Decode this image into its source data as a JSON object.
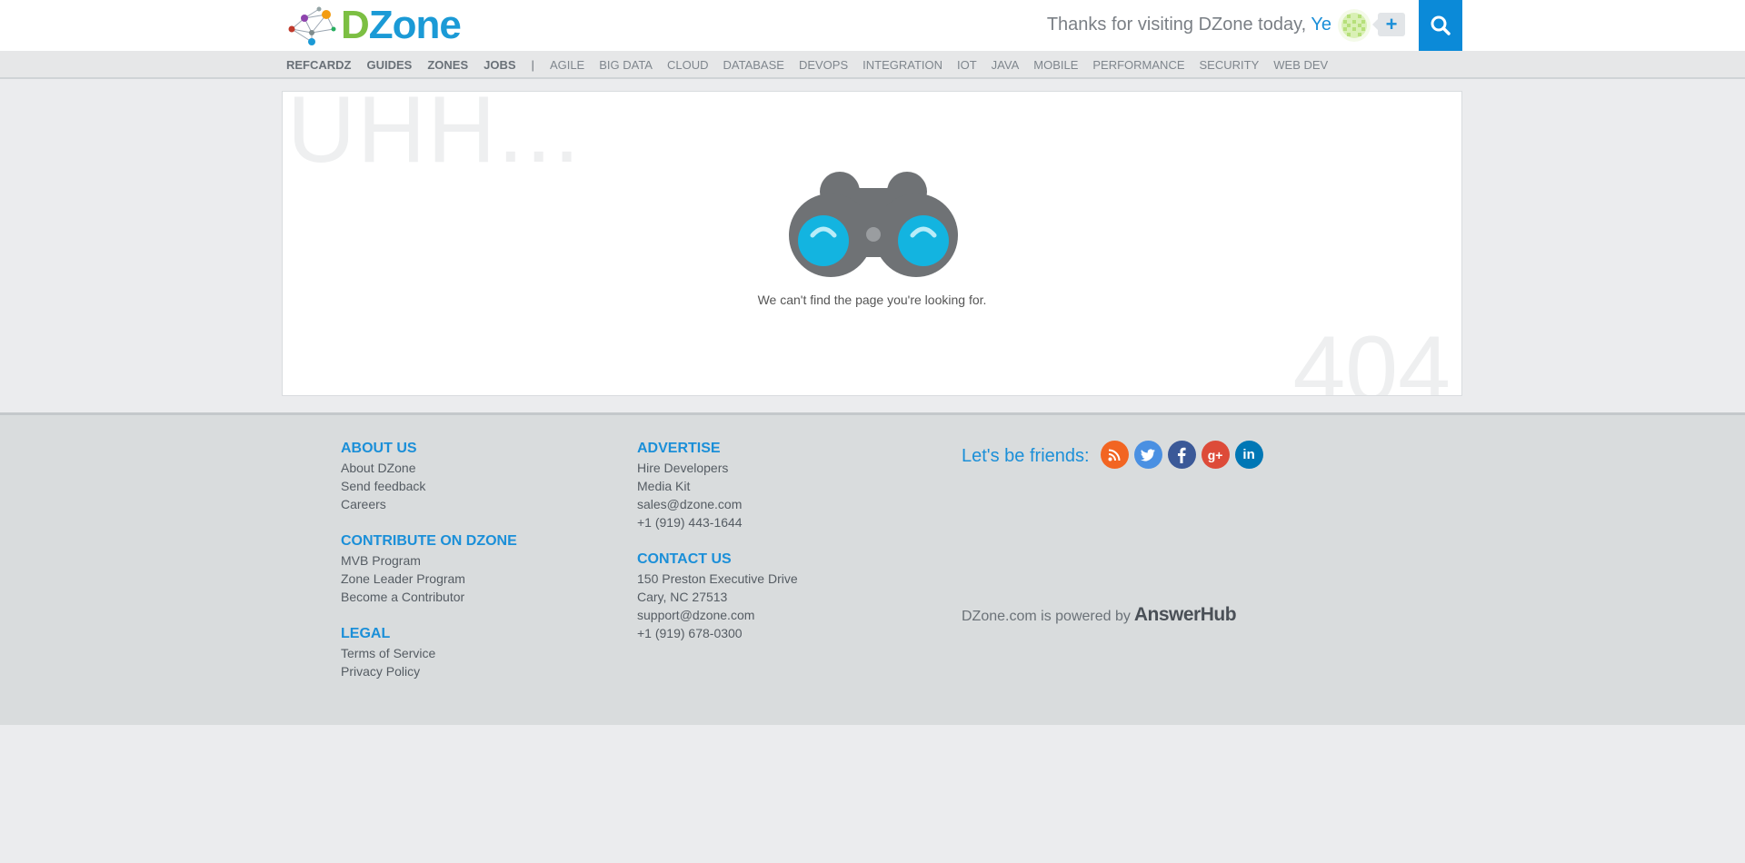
{
  "header": {
    "logo_d": "D",
    "logo_zone": "Zone",
    "greeting_prefix": "Thanks for visiting DZone today,",
    "greeting_user": "Ye",
    "plus_label": "+",
    "search_icon": "search-icon"
  },
  "nav": {
    "primary": [
      "REFCARDZ",
      "GUIDES",
      "ZONES",
      "JOBS"
    ],
    "separator": "|",
    "topics": [
      "AGILE",
      "BIG DATA",
      "CLOUD",
      "DATABASE",
      "DEVOPS",
      "INTEGRATION",
      "IOT",
      "JAVA",
      "MOBILE",
      "PERFORMANCE",
      "SECURITY",
      "WEB DEV"
    ]
  },
  "main": {
    "bg_text": "UHH...",
    "error_code": "404",
    "message": "We can't find the page you're looking for."
  },
  "footer": {
    "about": {
      "heading": "ABOUT US",
      "links": [
        "About DZone",
        "Send feedback",
        "Careers"
      ]
    },
    "contribute": {
      "heading": "CONTRIBUTE ON DZONE",
      "links": [
        "MVB Program",
        "Zone Leader Program",
        "Become a Contributor"
      ]
    },
    "legal": {
      "heading": "LEGAL",
      "links": [
        "Terms of Service",
        "Privacy Policy"
      ]
    },
    "advertise": {
      "heading": "ADVERTISE",
      "links": [
        "Hire Developers",
        "Media Kit",
        "sales@dzone.com",
        "+1 (919) 443-1644"
      ]
    },
    "contact": {
      "heading": "CONTACT US",
      "links": [
        "150 Preston Executive Drive",
        "Cary, NC 27513",
        "support@dzone.com",
        "+1 (919) 678-0300"
      ]
    },
    "friends_label": "Let's be friends:",
    "social": [
      {
        "name": "rss",
        "color": "#f26522"
      },
      {
        "name": "twitter",
        "color": "#4a90e2"
      },
      {
        "name": "facebook",
        "color": "#3b5998"
      },
      {
        "name": "google-plus",
        "color": "#dd4b39"
      },
      {
        "name": "linkedin",
        "color": "#0077b5"
      }
    ],
    "powered_by": "DZone.com is powered by",
    "answerhub": "AnswerHub"
  },
  "colors": {
    "accent": "#1b8fd8",
    "search_bg": "#0b8ad8",
    "binocular_body": "#6f7275",
    "lens": "#13b4e0"
  }
}
